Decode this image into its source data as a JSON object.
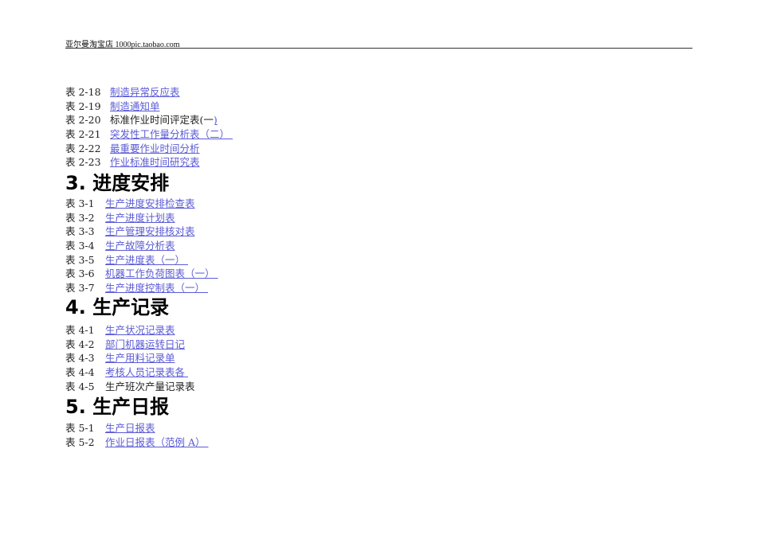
{
  "header": {
    "text": "亚尔曼淘宝店 1000pic.taobao.com"
  },
  "section2": {
    "items": [
      {
        "label": "表 2-18",
        "link": "制造异常反应表"
      },
      {
        "label": "表 2-19",
        "link": "制造通知单"
      },
      {
        "label": "表 2-20",
        "plain": "标准作业时间评定表(一",
        "link": ")"
      },
      {
        "label": "表 2-21",
        "link": "突发性工作量分析表（二） "
      },
      {
        "label": "表 2-22",
        "link": "最重要作业时间分析"
      },
      {
        "label": "表 2-23",
        "link": "作业标准时间研究表"
      }
    ]
  },
  "section3": {
    "title": "3. 进度安排",
    "items": [
      {
        "label": "表 3-1",
        "link": "生产进度安排检查表"
      },
      {
        "label": "表 3-2",
        "link": "生产进度计划表"
      },
      {
        "label": "表 3-3",
        "link": "生产管理安排核对表"
      },
      {
        "label": "表 3-4",
        "link": "生产故障分析表"
      },
      {
        "label": "表 3-5",
        "link": "生产进度表（一） "
      },
      {
        "label": "表 3-6",
        "link": "机器工作负荷图表（一） "
      },
      {
        "label": "表 3-7",
        "link": "生产进度控制表（一） "
      }
    ]
  },
  "section4": {
    "title": "4. 生产记录",
    "items": [
      {
        "label": "表 4-1",
        "link": "生产状况记录表"
      },
      {
        "label": "表 4-2",
        "link": "部门机器运转日记"
      },
      {
        "label": "表 4-3",
        "link": "生产用料记录单"
      },
      {
        "label": "表 4-4",
        "link": "考核人员记录表各 "
      },
      {
        "label": "表 4-5",
        "plain": "生产班次产量记录表"
      }
    ]
  },
  "section5": {
    "title": "5. 生产日报",
    "items": [
      {
        "label": "表 5-1",
        "link": "生产日报表"
      },
      {
        "label": "表 5-2",
        "link": "作业日报表（范例 A） "
      }
    ]
  }
}
